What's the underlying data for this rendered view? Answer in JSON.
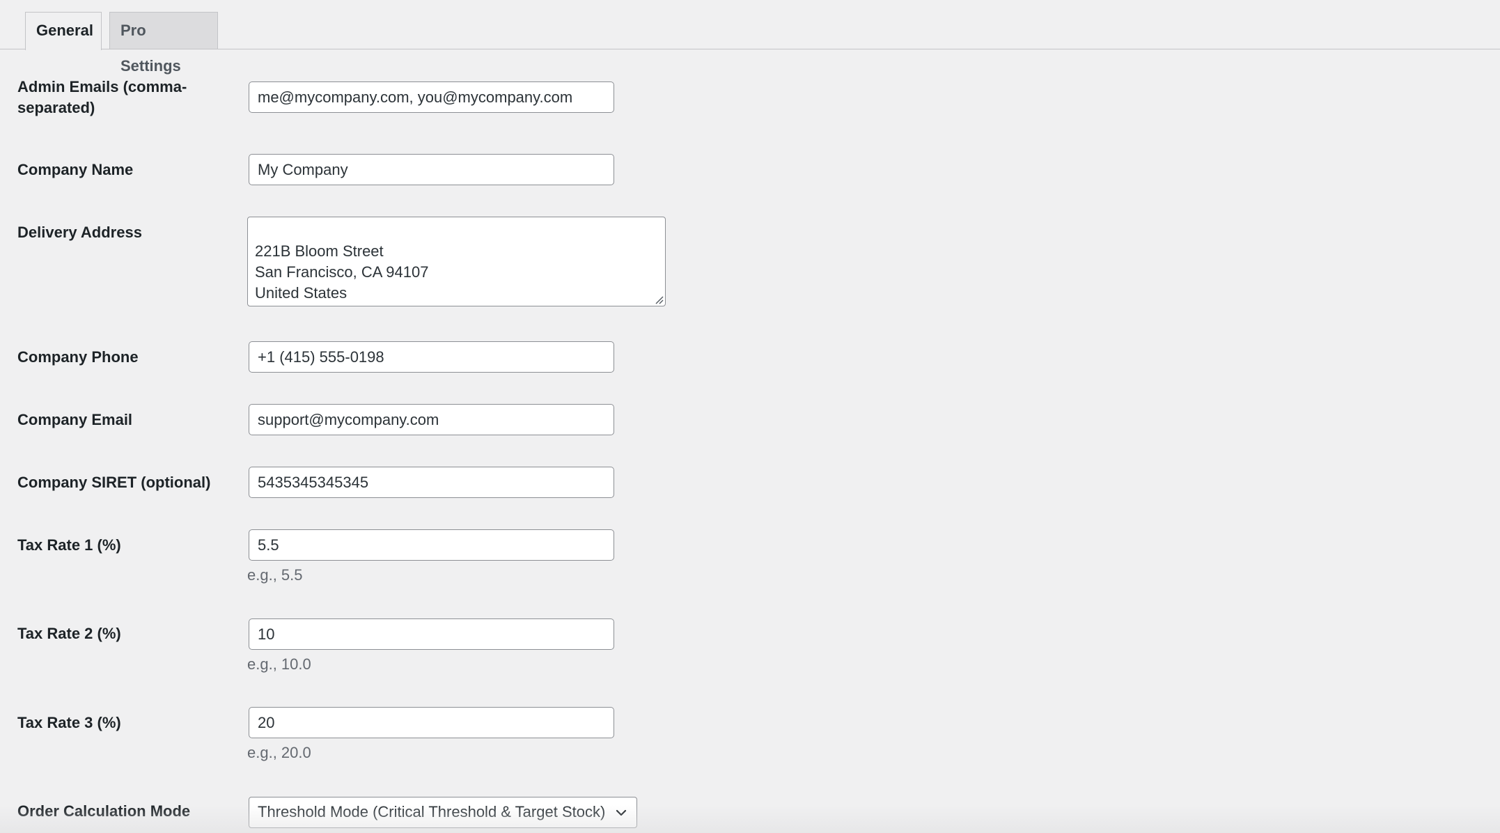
{
  "tabs": [
    {
      "label": "General",
      "active": true
    },
    {
      "label": "Pro Settings",
      "active": false
    }
  ],
  "fields": {
    "admin_emails": {
      "label": "Admin Emails (comma-separated)",
      "value": "me@mycompany.com, you@mycompany.com"
    },
    "company_name": {
      "label": "Company Name",
      "value": "My Company"
    },
    "delivery_address": {
      "label": "Delivery Address",
      "value": "221B Bloom Street\nSan Francisco, CA 94107\nUnited States"
    },
    "company_phone": {
      "label": "Company Phone",
      "value": "+1 (415) 555-0198"
    },
    "company_email": {
      "label": "Company Email",
      "value": "support@mycompany.com"
    },
    "company_siret": {
      "label": "Company SIRET (optional)",
      "value": "5435345345345"
    },
    "tax_rate_1": {
      "label": "Tax Rate 1 (%)",
      "value": "5.5",
      "hint": "e.g., 5.5"
    },
    "tax_rate_2": {
      "label": "Tax Rate 2 (%)",
      "value": "10",
      "hint": "e.g., 10.0"
    },
    "tax_rate_3": {
      "label": "Tax Rate 3 (%)",
      "value": "20",
      "hint": "e.g., 20.0"
    },
    "order_calculation_mode": {
      "label": "Order Calculation Mode",
      "value": "Threshold Mode (Critical Threshold & Target Stock)"
    }
  },
  "icons": {
    "select_arrow": "chevron-down-icon",
    "textarea_grip": "resize-grip-icon"
  },
  "colors": {
    "background": "#f0f0f1",
    "inactive_tab": "#dcdcde",
    "border": "#8c8f94",
    "hint_text": "#646970"
  }
}
